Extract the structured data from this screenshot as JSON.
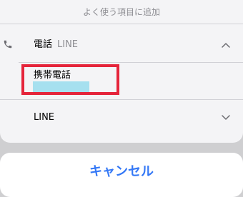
{
  "sheet": {
    "title": "よく使う項目に追加",
    "phone_row": {
      "label": "電話",
      "app": "LINE"
    },
    "mobile_row": {
      "label": "携帯電話"
    },
    "line_row": {
      "label": "LINE"
    }
  },
  "cancel": {
    "label": "キャンセル"
  },
  "colors": {
    "accent": "#3478f6",
    "highlight": "#e5243a",
    "redaction": "#a6e0ef"
  },
  "icons": {
    "phone": "phone-icon",
    "collapse": "chevron-up-icon",
    "expand": "chevron-down-icon"
  }
}
